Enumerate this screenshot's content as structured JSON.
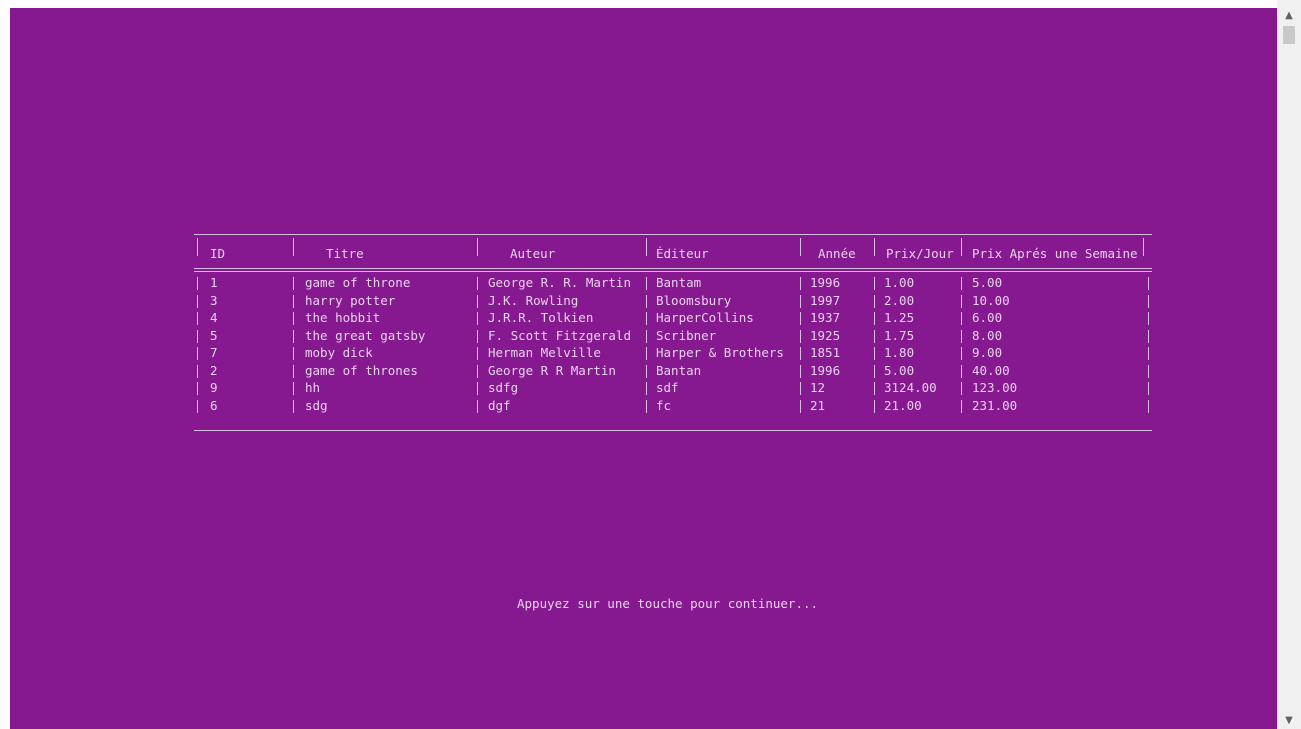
{
  "table": {
    "headers": [
      "ID",
      "Titre",
      "Auteur",
      "Éditeur",
      "Année",
      "Prix/Jour",
      "Prix Aprés une Semaine"
    ],
    "rows": [
      [
        "1",
        "game of throne",
        "George R. R. Martin",
        "Bantam",
        "1996",
        "1.00",
        "5.00"
      ],
      [
        "3",
        "harry potter",
        "J.K. Rowling",
        "Bloomsbury",
        "1997",
        "2.00",
        "10.00"
      ],
      [
        "4",
        "the hobbit",
        "J.R.R. Tolkien",
        "HarperCollins",
        "1937",
        "1.25",
        "6.00"
      ],
      [
        "5",
        "the great gatsby",
        "F. Scott Fitzgerald",
        "Scribner",
        "1925",
        "1.75",
        "8.00"
      ],
      [
        "7",
        "moby dick",
        "Herman Melville",
        "Harper & Brothers",
        "1851",
        "1.80",
        "9.00"
      ],
      [
        "2",
        "game of thrones",
        "George R R Martin",
        "Bantan",
        "1996",
        "5.00",
        "40.00"
      ],
      [
        "9",
        "hh",
        "sdfg",
        "sdf",
        "12",
        "3124.00",
        "123.00"
      ],
      [
        "6",
        "sdg",
        "dgf",
        "fc",
        "21",
        "21.00",
        "231.00"
      ]
    ]
  },
  "prompt": "Appuyez sur une touche pour continuer...",
  "scrollbar": {
    "up_icon": "▲",
    "down_icon": "▼"
  },
  "colors": {
    "background": "#86198f",
    "text": "#e9d2ef"
  }
}
